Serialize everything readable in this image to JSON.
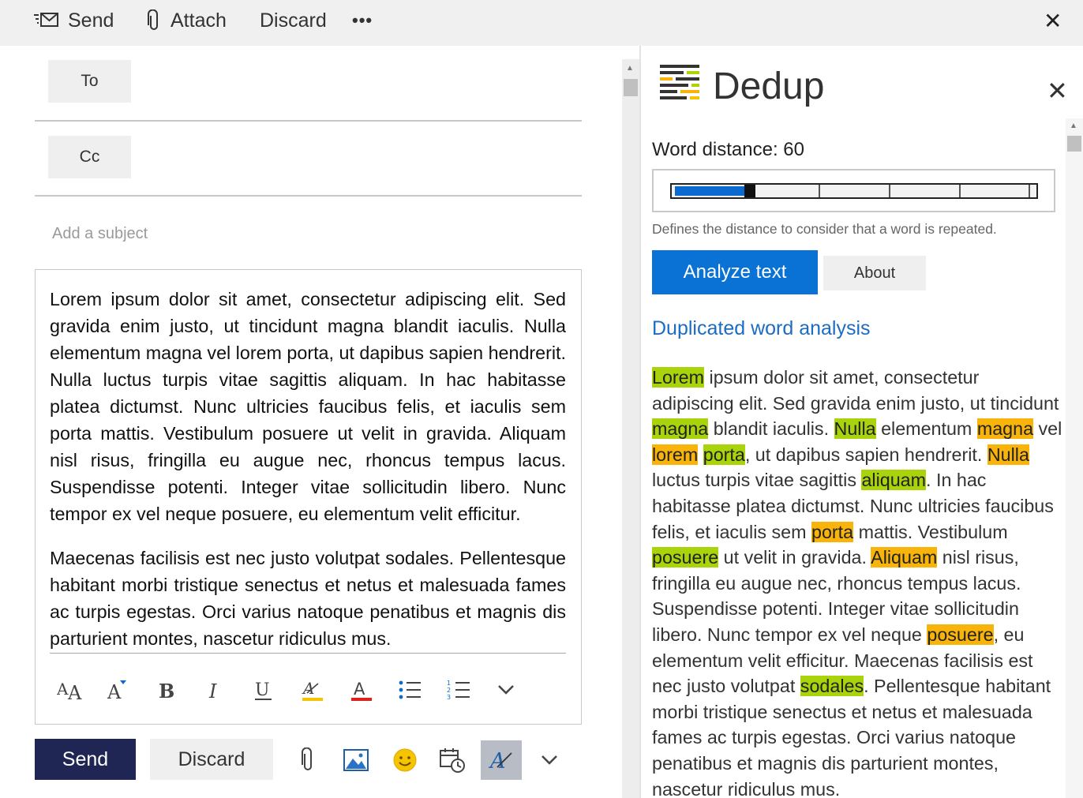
{
  "toolbar": {
    "send_label": "Send",
    "attach_label": "Attach",
    "discard_label": "Discard",
    "more_label": "•••",
    "close_label": "✕"
  },
  "compose": {
    "to_label": "To",
    "cc_label": "Cc",
    "subject_placeholder": "Add a subject",
    "body_paragraphs": [
      "Lorem ipsum dolor sit amet, consectetur adipiscing elit. Sed gravida enim justo, ut tincidunt magna blandit iaculis. Nulla elementum magna vel lorem porta, ut dapibus sapien hendrerit. Nulla luctus turpis vitae sagittis aliquam. In hac habitasse platea dictumst. Nunc ultricies faucibus felis, et iaculis sem porta mattis. Vestibulum posuere ut velit in gravida. Aliquam nisl risus, fringilla eu augue nec, rhoncus tempus lacus. Suspendisse potenti. Integer vitae sollicitudin libero. Nunc tempor ex vel neque posuere, eu elementum velit efficitur.",
      "Maecenas facilisis est nec justo volutpat sodales. Pellentesque habitant morbi tristique senectus et netus et malesuada fames ac turpis egestas. Orci varius natoque penatibus et magnis dis parturient montes, nascetur ridiculus mus."
    ],
    "send_button": "Send",
    "discard_button": "Discard"
  },
  "dedup": {
    "title": "Dedup",
    "close_label": "✕",
    "word_distance_label": "Word distance: 60",
    "word_distance_value": 60,
    "slider_fill_fraction": 0.2,
    "hint": "Defines the distance to consider that a word is repeated.",
    "analyze_button": "Analyze text",
    "about_button": "About",
    "section_heading": "Duplicated word analysis",
    "highlight_colors": {
      "first_occurrence": "#a9d30b",
      "repeat": "#f8b40a"
    },
    "analysis_tokens": [
      {
        "t": "Lorem",
        "h": "g"
      },
      {
        "t": " ipsum dolor sit amet, consectetur adipiscing elit. Sed gravida enim justo, ut tincidunt ",
        "h": ""
      },
      {
        "t": "magna",
        "h": "g"
      },
      {
        "t": " blandit iaculis. ",
        "h": ""
      },
      {
        "t": "Nulla",
        "h": "g"
      },
      {
        "t": " elementum ",
        "h": ""
      },
      {
        "t": "magna",
        "h": "o"
      },
      {
        "t": " vel ",
        "h": ""
      },
      {
        "t": "lorem",
        "h": "o"
      },
      {
        "t": " ",
        "h": ""
      },
      {
        "t": "porta",
        "h": "g"
      },
      {
        "t": ", ut dapibus sapien  hendrerit. ",
        "h": ""
      },
      {
        "t": "Nulla",
        "h": "o"
      },
      {
        "t": " luctus turpis vitae sagittis ",
        "h": ""
      },
      {
        "t": "aliquam",
        "h": "g"
      },
      {
        "t": ". In hac habitasse platea dictumst. Nunc ultricies faucibus felis, et iaculis sem ",
        "h": ""
      },
      {
        "t": "porta",
        "h": "o"
      },
      {
        "t": " mattis. Vestibulum ",
        "h": ""
      },
      {
        "t": "posuere",
        "h": "g"
      },
      {
        "t": " ut velit in gravida. ",
        "h": ""
      },
      {
        "t": "Aliquam",
        "h": "o"
      },
      {
        "t": " nisl risus, fringilla eu augue nec, rhoncus tempus lacus. Suspendisse potenti. Integer vitae sollicitudin libero. Nunc tempor ex vel neque ",
        "h": ""
      },
      {
        "t": "posuere",
        "h": "o"
      },
      {
        "t": ", eu elementum velit  efficitur. Maecenas facilisis est nec justo volutpat ",
        "h": ""
      },
      {
        "t": "sodales",
        "h": "g"
      },
      {
        "t": ". Pellentesque habitant morbi tristique senectus et netus et malesuada fames ac turpis egestas. Orci varius natoque penatibus et magnis  dis parturient montes, nascetur ridiculus mus.",
        "h": ""
      }
    ]
  }
}
